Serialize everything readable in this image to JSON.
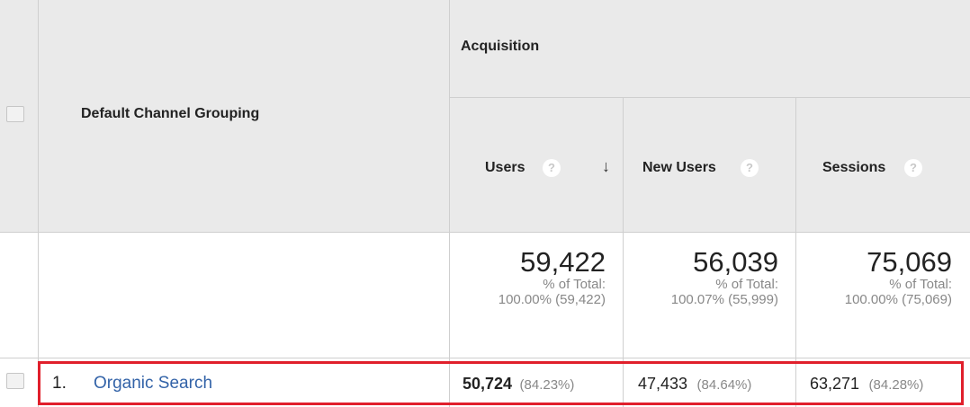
{
  "header": {
    "dimension_label": "Default Channel Grouping",
    "group_label": "Acquisition",
    "help_glyph": "?",
    "sort_glyph": "↓",
    "columns": [
      {
        "label": "Users"
      },
      {
        "label": "New Users"
      },
      {
        "label": "Sessions"
      }
    ]
  },
  "totals": [
    {
      "value": "59,422",
      "pct_label": "% of Total:",
      "pct_detail": "100.00% (59,422)"
    },
    {
      "value": "56,039",
      "pct_label": "% of Total:",
      "pct_detail": "100.07% (55,999)"
    },
    {
      "value": "75,069",
      "pct_label": "% of Total:",
      "pct_detail": "100.00% (75,069)"
    }
  ],
  "rows": [
    {
      "index": "1.",
      "channel": "Organic Search",
      "cells": [
        {
          "value": "50,724",
          "pct": "(84.23%)"
        },
        {
          "value": "47,433",
          "pct": "(84.64%)"
        },
        {
          "value": "63,271",
          "pct": "(84.28%)"
        }
      ]
    }
  ],
  "colors": {
    "header_bg": "#eaeaea",
    "link": "#3363a8",
    "highlight": "#e01f2b",
    "muted": "#888888"
  },
  "icons": [
    "help-circle-icon",
    "sort-down-arrow-icon",
    "checkbox-icon"
  ]
}
